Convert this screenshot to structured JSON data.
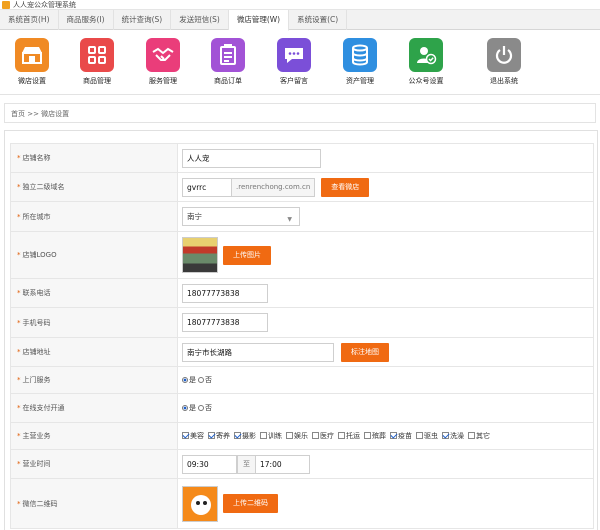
{
  "window": {
    "title": "人人宠公众管理系统"
  },
  "tabs": [
    {
      "label": "系统首页(H)"
    },
    {
      "label": "商品服务(I)"
    },
    {
      "label": "统计查询(S)"
    },
    {
      "label": "发送短信(S)"
    },
    {
      "label": "微店管理(W)",
      "active": true
    },
    {
      "label": "系统设置(C)"
    }
  ],
  "toolbar": [
    {
      "label": "微店设置",
      "icon": "shop-icon",
      "color": "#f08a24"
    },
    {
      "label": "商品管理",
      "icon": "grid-icon",
      "color": "#e94a4a"
    },
    {
      "label": "服务管理",
      "icon": "handshake-icon",
      "color": "#ea3d7a"
    },
    {
      "label": "商品订单",
      "icon": "clipboard-icon",
      "color": "#a253d6"
    },
    {
      "label": "客户留言",
      "icon": "chat-icon",
      "color": "#7b4fd8"
    },
    {
      "label": "资产管理",
      "icon": "database-icon",
      "color": "#2f8fe0"
    },
    {
      "label": "公众号设置",
      "icon": "user-check-icon",
      "color": "#2ea34a"
    },
    {
      "label": "退出系统",
      "icon": "power-icon",
      "color": "#8a8a8a"
    }
  ],
  "breadcrumb": "首页 >> 微店设置",
  "form": {
    "shop_name": {
      "label": "店铺名称",
      "value": "人人宠"
    },
    "subdomain": {
      "label": "独立二级域名",
      "value": "gvrrc",
      "suffix": ".renrenchong.com.cn",
      "button": "查看微店"
    },
    "city": {
      "label": "所在城市",
      "value": "南宁"
    },
    "logo": {
      "label": "店铺LOGO",
      "button": "上传图片"
    },
    "phone": {
      "label": "联系电话",
      "value": "18077773838"
    },
    "mobile": {
      "label": "手机号码",
      "value": "18077773838"
    },
    "address": {
      "label": "店铺地址",
      "value": "南宁市长湖路",
      "button": "标注地图"
    },
    "door_service": {
      "label": "上门服务",
      "options": [
        "是",
        "否"
      ],
      "selected": "是"
    },
    "online_pay": {
      "label": "在线支付开通",
      "options": [
        "是",
        "否"
      ],
      "selected": "是"
    },
    "business": {
      "label": "主营业务",
      "items": [
        {
          "text": "美容",
          "checked": true
        },
        {
          "text": "寄养",
          "checked": true
        },
        {
          "text": "摄影",
          "checked": true
        },
        {
          "text": "训练",
          "checked": false
        },
        {
          "text": "娱乐",
          "checked": false
        },
        {
          "text": "医疗",
          "checked": false
        },
        {
          "text": "托运",
          "checked": false
        },
        {
          "text": "殡葬",
          "checked": false
        },
        {
          "text": "疫苗",
          "checked": true
        },
        {
          "text": "驱虫",
          "checked": false
        },
        {
          "text": "洗澡",
          "checked": true
        },
        {
          "text": "其它",
          "checked": false
        }
      ]
    },
    "hours": {
      "label": "营业时间",
      "from": "09:30",
      "sep": "至",
      "to": "17:00"
    },
    "wechat_qr": {
      "label": "微信二维码",
      "button": "上传二维码"
    }
  }
}
